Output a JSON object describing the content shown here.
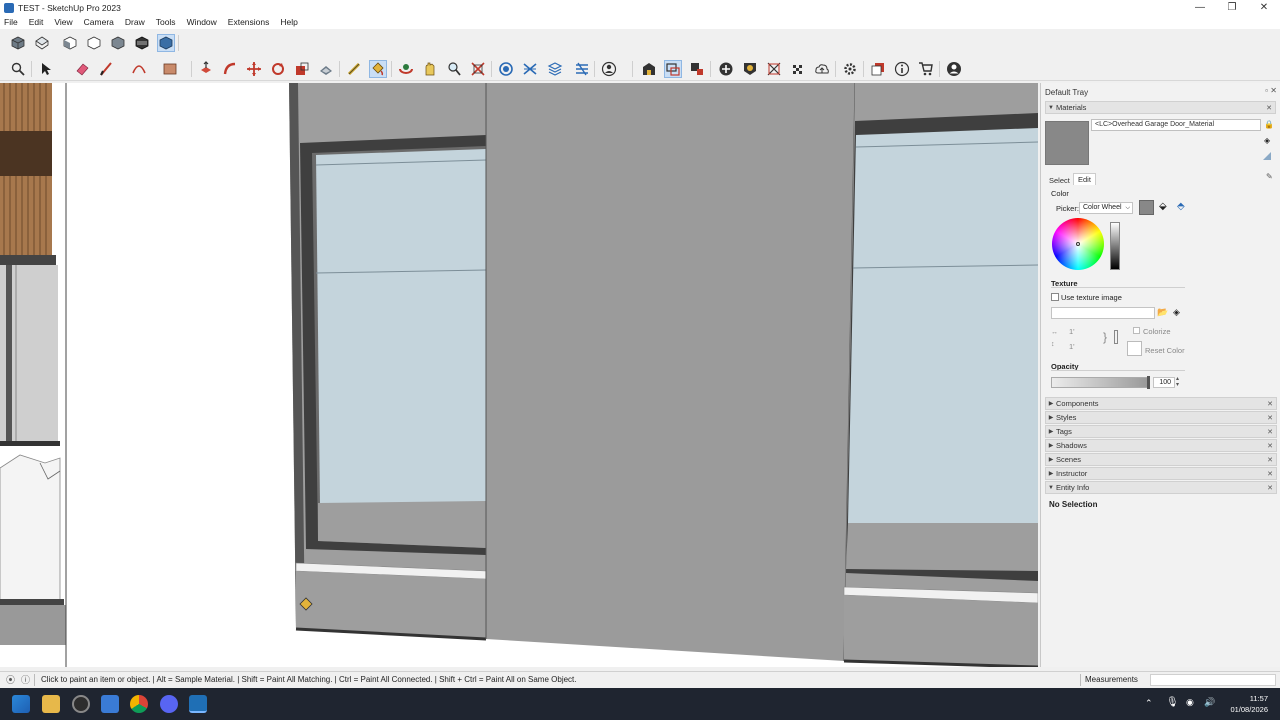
{
  "window": {
    "title": "TEST - SketchUp Pro 2023",
    "minimize": "—",
    "maximize": "❐",
    "close": "✕"
  },
  "menu": [
    "File",
    "Edit",
    "View",
    "Camera",
    "Draw",
    "Tools",
    "Window",
    "Extensions",
    "Help"
  ],
  "toolbar1_icons": [
    "iso-view-icon",
    "top-view-icon",
    "front-view-icon",
    "right-view-icon",
    "back-view-icon",
    "left-view-icon",
    "bottom-view-icon"
  ],
  "toolbar2_icons": [
    "zoom-icon",
    "select-icon",
    "eraser-icon",
    "line-icon",
    "arc-icon",
    "rectangle-icon",
    "push-pull-icon",
    "follow-me-icon",
    "move-icon",
    "rotate-icon",
    "scale-icon",
    "offset-icon",
    "tape-measure-icon",
    "paint-bucket-icon",
    "orbit-icon",
    "pan-icon",
    "zoom-window-icon",
    "zoom-extents-icon",
    "section-plane-icon",
    "sandbox-icon",
    "layers-icon",
    "styles-icon",
    "user-icon",
    "warehouse-icon",
    "extension-warehouse-icon",
    "layout-icon",
    "add-location-icon",
    "photo-textures-icon",
    "match-photo-icon",
    "cloud-icon",
    "settings-icon",
    "scenes-icon",
    "instructor-icon",
    "cart-icon",
    "account-icon"
  ],
  "tray": {
    "title": "Default Tray",
    "materials": {
      "header": "Materials",
      "material_name": "<LC>Overhead Garage Door_Material",
      "tabs": [
        "Select",
        "Edit"
      ],
      "color_label": "Color",
      "picker_label": "Picker:",
      "picker_value": "Color Wheel",
      "texture_label": "Texture",
      "use_texture": "Use texture image",
      "width_value": "1'",
      "height_value": "1'",
      "colorize": "Colorize",
      "reset_color": "Reset Color",
      "opacity_label": "Opacity",
      "opacity_value": "100"
    },
    "panels": [
      "Components",
      "Styles",
      "Tags",
      "Shadows",
      "Scenes",
      "Instructor",
      "Entity Info"
    ],
    "entity_info": "No Selection"
  },
  "status": {
    "hint": "Click to paint an item or object. | Alt = Sample Material. | Shift = Paint All Matching. | Ctrl = Paint All Connected. | Shift + Ctrl = Paint All on Same Object.",
    "measurements": "Measurements"
  },
  "taskbar": {
    "time": "11:57",
    "date": "01/08/2026"
  },
  "colors": {
    "accent": "#2a6ab5",
    "material_swatch": "#888888",
    "glass": "#c4d4dc",
    "wall_gray": "#9b9b9b"
  }
}
